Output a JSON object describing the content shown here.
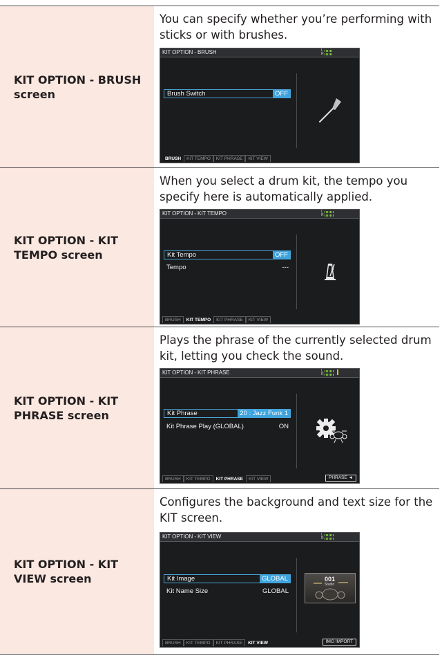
{
  "rows": [
    {
      "label": "KIT OPTION - BRUSH screen",
      "description": "You can specify whether you’re performing with sticks or with brushes.",
      "screen": {
        "title": "KIT OPTION - BRUSH",
        "params": [
          {
            "name": "Brush Switch",
            "value": "OFF",
            "selected": true
          }
        ],
        "icon": "brush-icon",
        "tabs": [
          "BRUSH",
          "KIT TEMPO",
          "KIT PHRASE",
          "KIT VIEW"
        ],
        "active_tab": 0
      }
    },
    {
      "label": "KIT OPTION - KIT TEMPO screen",
      "description": "When you select a drum kit, the tempo you specify here is automatically applied.",
      "screen": {
        "title": "KIT OPTION - KIT TEMPO",
        "params": [
          {
            "name": "Kit Tempo",
            "value": "OFF",
            "selected": true
          },
          {
            "name": "Tempo",
            "value": "---",
            "selected": false
          }
        ],
        "icon": "metronome-icon",
        "tabs": [
          "BRUSH",
          "KIT TEMPO",
          "KIT PHRASE",
          "KIT VIEW"
        ],
        "active_tab": 1
      }
    },
    {
      "label": "KIT OPTION - KIT PHRASE screen",
      "description": "Plays the phrase of the currently selected drum kit, letting you check the sound.",
      "screen": {
        "title": "KIT OPTION - KIT PHRASE",
        "params": [
          {
            "name": "Kit Phrase",
            "value": "20 : Jazz Funk 1",
            "selected": true
          },
          {
            "name": "Kit Phrase Play (GLOBAL)",
            "value": "ON",
            "selected": false
          }
        ],
        "icon": "gear-drum-icon",
        "tabs": [
          "BRUSH",
          "KIT TEMPO",
          "KIT PHRASE",
          "KIT VIEW"
        ],
        "active_tab": 2,
        "function_button": "PHRASE ◄"
      }
    },
    {
      "label": "KIT OPTION - KIT VIEW screen",
      "description": "Configures the background and text size for the KIT screen.",
      "screen": {
        "title": "KIT OPTION - KIT VIEW",
        "params": [
          {
            "name": "Kit Image",
            "value": "GLOBAL",
            "selected": true
          },
          {
            "name": "Kit Name Size",
            "value": "GLOBAL",
            "selected": false
          }
        ],
        "icon": "kit-thumbnail",
        "thumbnail_text": "001",
        "thumbnail_subtext": "Studio",
        "tabs": [
          "BRUSH",
          "KIT TEMPO",
          "KIT PHRASE",
          "KIT VIEW"
        ],
        "active_tab": 3,
        "function_button": "IMG IMPORT"
      }
    }
  ],
  "colors": {
    "label_bg": "#fbe8e1",
    "lcd_bg": "#1b1c1e",
    "select_accent": "#3da3de",
    "meter_green": "#7ecb3c"
  }
}
